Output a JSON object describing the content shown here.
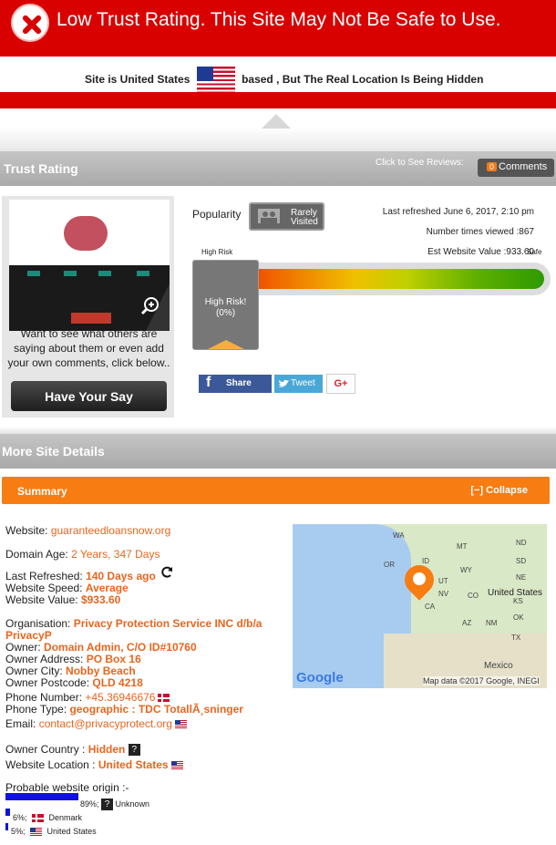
{
  "alert": {
    "title": "Low Trust Rating. This Site May Not Be Safe to Use."
  },
  "location": {
    "prefix": "Site is United States",
    "suffix": "based , But The Real Location Is Being Hidden"
  },
  "trust": {
    "header": "Trust Rating",
    "click_to_see": "Click to See Reviews:",
    "comments_count": "0",
    "comments_label": "Comments",
    "card_text": "Want to see what others are saying about them or even add your own comments, click below..",
    "have_say": "Have Your Say",
    "popularity_label": "Popularity",
    "popularity_value_1": "Rarely",
    "popularity_value_2": "Visited",
    "last_refreshed": "Last refreshed June 6, 2017, 2:10 pm",
    "times_viewed": "Number times viewed :867",
    "est_value": "Est Website Value :933.60",
    "high_risk_label": "High Risk",
    "safe_label": "Safe",
    "risk_status": "High Risk!",
    "risk_percent": "(0%)",
    "risk_level": 0,
    "share": "Share",
    "tweet": "Tweet",
    "gplus": "G+"
  },
  "more": {
    "header": "More Site Details",
    "summary": "Summary",
    "collapse": "[−] Collapse"
  },
  "details": {
    "website_label": "Website:",
    "website": "guaranteedloansnow.org",
    "age_label": "Domain Age:",
    "age": "2 Years, 347 Days",
    "refreshed_label": "Last Refreshed:",
    "refreshed": "140 Days ago",
    "speed_label": "Website Speed:",
    "speed": "Average",
    "value_label": "Website Value:",
    "value": "$933.60",
    "org_label": "Organisation:",
    "org_1": "Privacy Protection Service INC d/b/a",
    "org_2": "PrivacyP",
    "owner_label": "Owner:",
    "owner": "Domain Admin, C/O ID#10760",
    "address_label": "Owner Address:",
    "address": "PO Box 16",
    "city_label": "Owner City:",
    "city": "Nobby Beach",
    "postcode_label": "Owner Postcode:",
    "postcode": "QLD 4218",
    "phone_label": "Phone Number:",
    "phone": "+45.36946676",
    "phone_type_label": "Phone Type:",
    "phone_type": "geographic : TDC TotallÃ¸sninger",
    "email_label": "Email:",
    "email": "contact@privacyprotect.org",
    "country_label": "Owner Country :",
    "country": "Hidden",
    "web_loc_label": "Website Location  :",
    "web_loc": "United States"
  },
  "map": {
    "attribution": "Map data ©2017 Google, INEGI",
    "logo": "Google",
    "labels": [
      "WA",
      "MT",
      "ND",
      "OR",
      "ID",
      "SD",
      "WY",
      "NE",
      "NV",
      "UT",
      "CO",
      "KS",
      "CA",
      "United States",
      "AZ",
      "NM",
      "OK",
      "TX",
      "Mexico"
    ]
  },
  "origin": {
    "title": "Probable website origin :-",
    "rows": [
      {
        "percent": "89%;",
        "country": "Unknown"
      },
      {
        "percent": "6%;",
        "country": "Denmark"
      },
      {
        "percent": "5%;",
        "country": "United States"
      }
    ]
  }
}
